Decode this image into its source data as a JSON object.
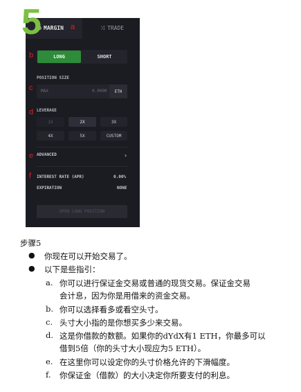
{
  "step_number": "5",
  "tabs": {
    "margin_icon": "gear-icon",
    "margin_label": "MARGIN",
    "trade_icon": "cross-arrows-icon",
    "trade_label": "TRADE"
  },
  "annotations": [
    "a",
    "b",
    "c",
    "d",
    "e",
    "f"
  ],
  "side": {
    "long_label": "LONG",
    "short_label": "SHORT",
    "selected": "LONG"
  },
  "position_size": {
    "label": "POSITION SIZE",
    "placeholder": "MAX",
    "value": "0.0000",
    "unit": "ETH"
  },
  "leverage": {
    "label": "LEVERAGE",
    "options": [
      "1X",
      "2X",
      "3X",
      "4X",
      "5X",
      "CUSTOM"
    ],
    "selected": "2X"
  },
  "advanced": {
    "label": "ADVANCED",
    "chevron": "›"
  },
  "interest_rate": {
    "label": "INTEREST RATE (APR)",
    "value": "0.00%"
  },
  "expiration": {
    "label": "EXPIRATION",
    "value": "NONE"
  },
  "open_button": "OPEN LONG POSITION",
  "instructions": {
    "step_title": "步骤5",
    "bullets": [
      "你现在可以开始交易了。",
      "以下是些指引："
    ],
    "items": [
      {
        "letter": "a.",
        "lines": [
          "你可以进行保证金交易或普通的现货交易。保证金交易",
          "会计息，因为你是用借来的资金交易。"
        ]
      },
      {
        "letter": "b.",
        "lines": [
          "你可以选择看多或看空头寸。"
        ]
      },
      {
        "letter": "c.",
        "lines": [
          "头寸大小指的是你想买多少来交易。"
        ]
      },
      {
        "letter": "d.",
        "lines": [
          "这是你借款的数额。如果你的dYdX有1 ETH，你最多可以",
          "借到5倍（你的头寸大小现应为5 ETH）。"
        ]
      },
      {
        "letter": "e.",
        "lines": [
          "在这里你可以设定你的头寸价格允许的下滑幅度。"
        ]
      },
      {
        "letter": "f.",
        "lines": [
          "你保证金（借款）的大小决定你所要支付的利息。"
        ]
      }
    ]
  },
  "colors": {
    "panel_bg": "#1b1b22",
    "long_green": "#2e8b3a",
    "annotation_red": "#e02020",
    "step_green": "#7bc043"
  }
}
